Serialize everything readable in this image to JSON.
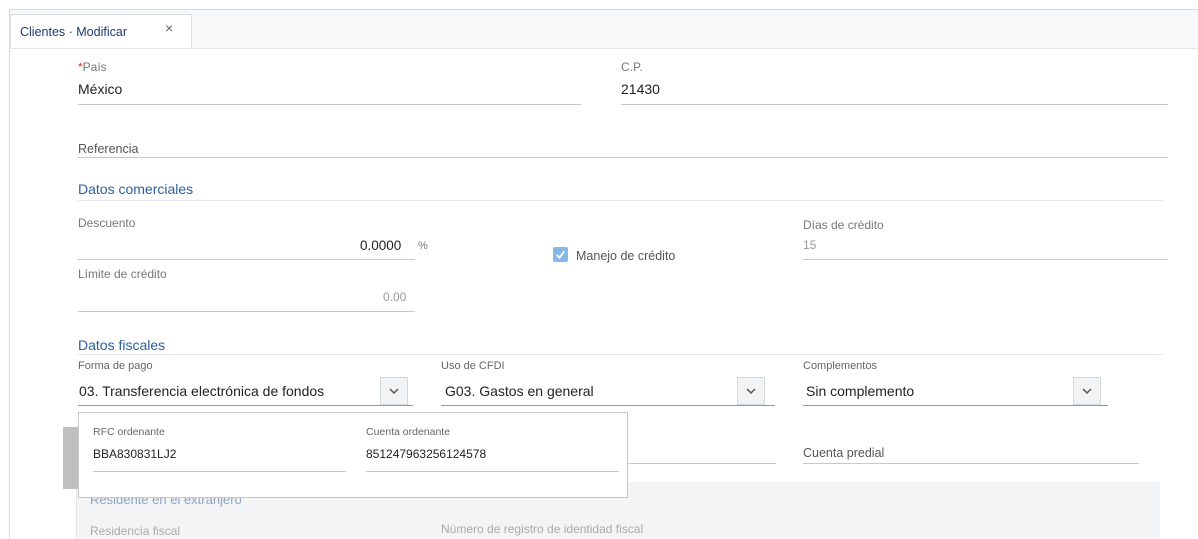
{
  "tab": {
    "label": "Clientes · Modificar",
    "close": "×"
  },
  "address": {
    "pais": {
      "required_mark": "*",
      "label": "País",
      "value": "México"
    },
    "cp": {
      "label": "C.P.",
      "value": "21430"
    },
    "referencia": {
      "placeholder": "Referencia"
    }
  },
  "comerciales": {
    "title": "Datos comerciales",
    "descuento": {
      "label": "Descuento",
      "value": "0.0000",
      "unit": "%"
    },
    "manejo_credito": {
      "label": "Manejo de crédito",
      "checked": true
    },
    "dias_credito": {
      "label": "Días de crédito",
      "value": "15"
    },
    "limite_credito": {
      "label": "Límite de crédito",
      "value": "0.00"
    }
  },
  "fiscales": {
    "title": "Datos fiscales",
    "forma_pago": {
      "label": "Forma de pago",
      "value": "03. Transferencia electrónica de fondos"
    },
    "uso_cfdi": {
      "label": "Uso de CFDI",
      "value": "G03. Gastos en general"
    },
    "complementos": {
      "label": "Complementos",
      "value": "Sin complemento"
    },
    "cuenta_predial": {
      "placeholder": "Cuenta predial"
    }
  },
  "popup": {
    "rfc_ordenante": {
      "label": "RFC ordenante",
      "value": "BBA830831LJ2"
    },
    "cuenta_ordenante": {
      "label": "Cuenta ordenante",
      "value": "851247963256124578"
    }
  },
  "extranjero": {
    "title": "Residente en el extranjero",
    "residencia_fiscal": {
      "label": "Residencia fiscal"
    },
    "num_registro": {
      "label": "Número de registro de identidad fiscal"
    }
  },
  "icons": {
    "chevron": "chevron-down-icon",
    "check": "check-icon",
    "close": "close-icon"
  },
  "colors": {
    "accent": "#2a5fa0",
    "tab_text": "#1d3a73",
    "checkbox": "#8ab8e6",
    "required": "#d9352a"
  }
}
